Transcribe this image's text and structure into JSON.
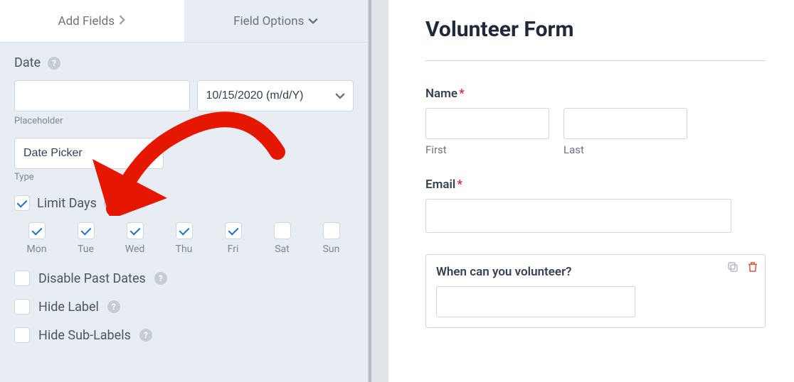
{
  "tabs": {
    "add_fields": "Add Fields",
    "field_options": "Field Options"
  },
  "field": {
    "label": "Date",
    "placeholder_value": "",
    "format_value": "10/15/2020 (m/d/Y)",
    "placeholder_label": "Placeholder",
    "type_label": "Type",
    "type_value": "Date Picker"
  },
  "options": {
    "limit_days": {
      "label": "Limit Days",
      "checked": true
    },
    "days": [
      {
        "code": "Mon",
        "checked": true
      },
      {
        "code": "Tue",
        "checked": true
      },
      {
        "code": "Wed",
        "checked": true
      },
      {
        "code": "Thu",
        "checked": true
      },
      {
        "code": "Fri",
        "checked": true
      },
      {
        "code": "Sat",
        "checked": false
      },
      {
        "code": "Sun",
        "checked": false
      }
    ],
    "disable_past": {
      "label": "Disable Past Dates",
      "checked": false
    },
    "hide_label": {
      "label": "Hide Label",
      "checked": false
    },
    "hide_sublabels": {
      "label": "Hide Sub-Labels",
      "checked": false
    }
  },
  "preview": {
    "title": "Volunteer Form",
    "name_label": "Name",
    "first": "First",
    "last": "Last",
    "email_label": "Email",
    "volunteer_label": "When can you volunteer?"
  }
}
